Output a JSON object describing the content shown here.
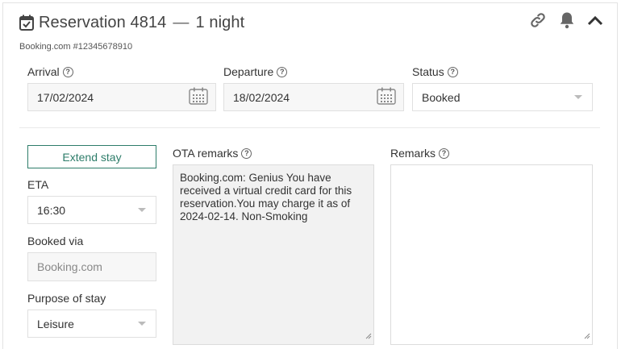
{
  "header": {
    "title": "Reservation 4814",
    "separator": "—",
    "nights": "1 night",
    "subtitle": "Booking.com #12345678910",
    "icons": [
      "calendar-check-icon",
      "link-icon",
      "bell-icon",
      "chevron-up-icon"
    ]
  },
  "arrival": {
    "label": "Arrival",
    "value": "17/02/2024"
  },
  "departure": {
    "label": "Departure",
    "value": "18/02/2024"
  },
  "status": {
    "label": "Status",
    "value": "Booked"
  },
  "extend_stay": {
    "label": "Extend stay"
  },
  "eta": {
    "label": "ETA",
    "value": "16:30"
  },
  "booked_via": {
    "label": "Booked via",
    "placeholder": "Booking.com"
  },
  "purpose": {
    "label": "Purpose of stay",
    "value": "Leisure"
  },
  "ota_remarks": {
    "label": "OTA remarks",
    "text": "Booking.com: Genius You have received a virtual credit card for this reservation.You may charge it as of 2024-02-14. Non-Smoking"
  },
  "remarks": {
    "label": "Remarks",
    "text": ""
  },
  "help_glyph": "?",
  "colors": {
    "accent": "#2e7d6a",
    "icon": "#666666"
  }
}
